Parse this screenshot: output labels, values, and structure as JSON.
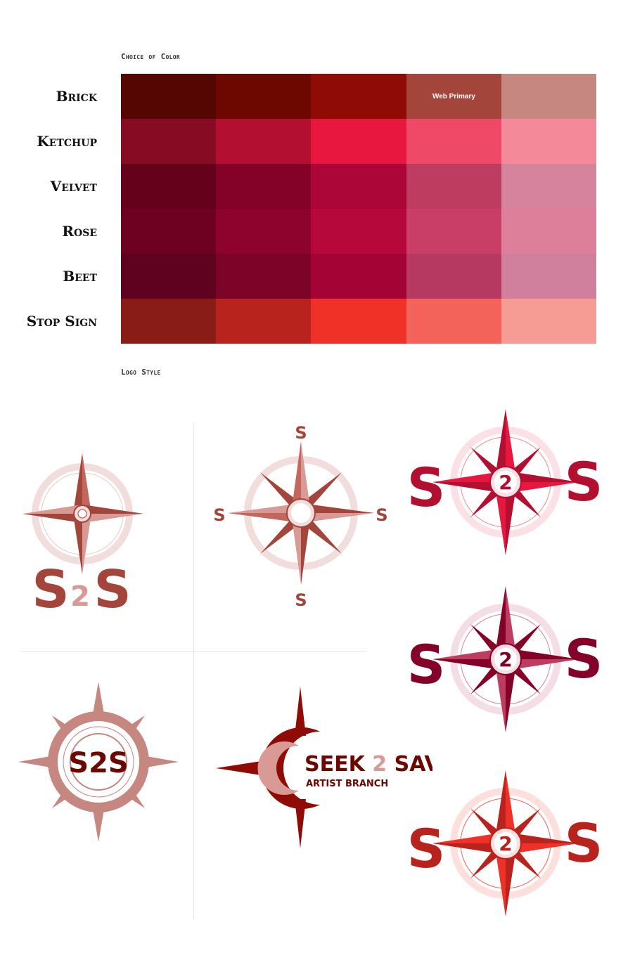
{
  "headers": {
    "color_title": "Choice of Color",
    "logo_title": "Logo Style"
  },
  "palettes": [
    {
      "name": "Brick",
      "shades": [
        "#560602",
        "#6d0801",
        "#8e0c05",
        "#a3453b",
        "#c5877f"
      ],
      "notes": [
        "",
        "",
        "",
        "Web Primary",
        ""
      ]
    },
    {
      "name": "Ketchup",
      "shades": [
        "#870b22",
        "#b31031",
        "#e8173f",
        "#ee4a68",
        "#f4899a"
      ],
      "notes": [
        "",
        "",
        "",
        "",
        ""
      ]
    },
    {
      "name": "Velvet",
      "shades": [
        "#65011a",
        "#840227",
        "#ab0637",
        "#bd3c60",
        "#d6849d"
      ],
      "notes": [
        "",
        "",
        "",
        "",
        ""
      ]
    },
    {
      "name": "Rose",
      "shades": [
        "#6e0121",
        "#8d032e",
        "#b6083b",
        "#c93e67",
        "#dd7f9b"
      ],
      "notes": [
        "",
        "",
        "",
        "",
        ""
      ]
    },
    {
      "name": "Beet",
      "shades": [
        "#5f0220",
        "#7e0329",
        "#a30435",
        "#b63961",
        "#d07f9c"
      ],
      "notes": [
        "",
        "",
        "",
        "",
        ""
      ]
    },
    {
      "name": "Stop Sign",
      "shades": [
        "#8a1c17",
        "#b9231e",
        "#ef3128",
        "#f3635a",
        "#f79c94"
      ],
      "notes": [
        "",
        "",
        "",
        "",
        ""
      ]
    }
  ],
  "logos": {
    "s2s_badge": {
      "letter_left": "S",
      "digit": "2",
      "letter_right": "S"
    },
    "cardinal": {
      "north": "S",
      "south": "S",
      "west": "S",
      "east": "S"
    },
    "ring_badge": {
      "text": "S2S"
    },
    "wordmark": {
      "word1": "SEEK",
      "digit": "2",
      "word2": "SAVE",
      "subtitle": "ARTIST BRANCH"
    },
    "variant_right": {
      "letter": "S",
      "digit": "2"
    }
  },
  "colors": {
    "brick_dark": "#8e0c05",
    "brick_pale": "#c5877f",
    "rose_pale": "#dd7f9b",
    "ketchup": "#e8173f",
    "velvet": "#ab0637",
    "stop": "#ef3128"
  }
}
